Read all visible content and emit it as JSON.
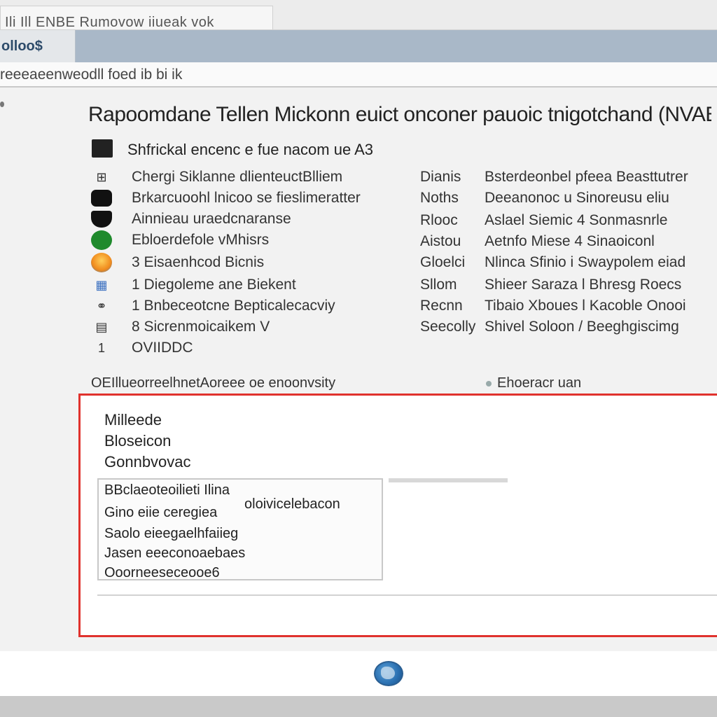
{
  "window": {
    "title": "Ili Ill ENBE Rumovow iiueak vok"
  },
  "toolbar": {
    "tab_label": "olloo$"
  },
  "menubar": {
    "text": "reeeaeenweodll foed ib bi ik"
  },
  "content": {
    "heading": "Rapoomdane Tellen Mickonn euict onconer pauoic tnigotchand (NVAB",
    "subheading": "Shfrickal encenc e fue nacom ue A3",
    "left_items": [
      {
        "icon": "grid-icon",
        "glyph": "⊞",
        "label": "Chergi Siklanne dlienteuctBlliem"
      },
      {
        "icon": "black-rounded-square-icon",
        "glyph": "",
        "label": "Brkarcuoohl lnicoo se fieslimeratter"
      },
      {
        "icon": "black-shield-icon",
        "glyph": "",
        "label": "Ainnieau uraedcnaranse"
      },
      {
        "icon": "green-circle-icon",
        "glyph": "",
        "label": "Ebloerdefole vMhisrs"
      },
      {
        "icon": "orange-globe-icon",
        "glyph": "",
        "label": "3 Eisaenhcod Bicnis"
      },
      {
        "icon": "blue-grid-icon",
        "glyph": "▦",
        "label": "1 Diegoleme ane Biekent"
      },
      {
        "icon": "link-icon",
        "glyph": "⚭",
        "label": "1 Bnbeceotcne Bepticalecacviy"
      },
      {
        "icon": "table-icon",
        "glyph": "▤",
        "label": "8 Sicrenmoicaikem V"
      },
      {
        "icon": "number-icon",
        "glyph": "1",
        "label": "OVIIDDC"
      }
    ],
    "right_items": [
      {
        "key": "Dianis",
        "value": "Bsterdeonbel pfeea Beasttutrer"
      },
      {
        "key": "Noths",
        "value": "Deeanonoc u Sinoreusu eliu"
      },
      {
        "key": "Rlooc",
        "value": "Aslael Siemic 4 Sonmasnrle"
      },
      {
        "key": "Aistou",
        "value": "Aetnfo Miese 4 Sinaoiconl"
      },
      {
        "key": "Gloelci",
        "value": "Nlinca Sfinio i Swaypolem eiad"
      },
      {
        "key": "Sllom",
        "value": "Shieer Saraza l Bhresg Roecs"
      },
      {
        "key": "Recnn",
        "value": "Tibaio Xboues l Kacoble Onooi"
      },
      {
        "key": "Seecolly",
        "value": "Shivel Soloon / Beeghgiscimg"
      }
    ],
    "section_left": "OEIllueorreelhnetAoreee oe enoonvsity",
    "section_right": "Ehoeracr uan"
  },
  "panel": {
    "lines": [
      "Milleede",
      "Bloseicon",
      "Gonnbvovac"
    ],
    "inner_lines": [
      "BBclaeoteoilieti Ilina",
      "Gino eiie ceregiea",
      "Saolo eieegaelhfaiieg",
      "Jasen eeeconoaebaes",
      "Ooorneeseceooe6"
    ],
    "inner_right": "oloivicelebacon"
  }
}
